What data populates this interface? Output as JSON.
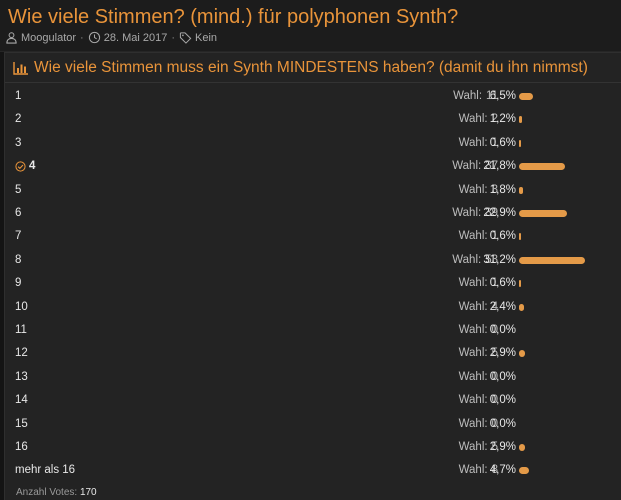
{
  "thread": {
    "title": "Wie viele Stimmen? (mind.) für polyphonen Synth?",
    "author": "Moogulator",
    "date": "28. Mai 2017",
    "tags": "Kein",
    "separator": "·",
    "icons": {
      "author": "user-icon",
      "date": "clock-icon",
      "tags": "tag-icon"
    }
  },
  "poll": {
    "icon": "bar-chart-icon",
    "question": "Wie viele Stimmen muss ein Synth MINDESTENS haben? (damit du ihn nimmst)",
    "vote_prefix": "Wahl:",
    "total_label": "Anzahl Votes:",
    "total_value": "170",
    "bar_color": "#e49a48",
    "accent_color": "#e9943a",
    "options": [
      {
        "label": "1",
        "votes": "11",
        "percent": "6,5%",
        "share": 6.5,
        "voted": false
      },
      {
        "label": "2",
        "votes": "2",
        "percent": "1,2%",
        "share": 1.2,
        "voted": false
      },
      {
        "label": "3",
        "votes": "1",
        "percent": "0,6%",
        "share": 0.6,
        "voted": false
      },
      {
        "label": "4",
        "votes": "37",
        "percent": "21,8%",
        "share": 21.8,
        "voted": true
      },
      {
        "label": "5",
        "votes": "3",
        "percent": "1,8%",
        "share": 1.8,
        "voted": false
      },
      {
        "label": "6",
        "votes": "39",
        "percent": "22,9%",
        "share": 22.9,
        "voted": false
      },
      {
        "label": "7",
        "votes": "1",
        "percent": "0,6%",
        "share": 0.6,
        "voted": false
      },
      {
        "label": "8",
        "votes": "53",
        "percent": "31,2%",
        "share": 31.2,
        "voted": false
      },
      {
        "label": "9",
        "votes": "1",
        "percent": "0,6%",
        "share": 0.6,
        "voted": false
      },
      {
        "label": "10",
        "votes": "4",
        "percent": "2,4%",
        "share": 2.4,
        "voted": false
      },
      {
        "label": "11",
        "votes": "0",
        "percent": "0,0%",
        "share": 0,
        "voted": false
      },
      {
        "label": "12",
        "votes": "5",
        "percent": "2,9%",
        "share": 2.9,
        "voted": false
      },
      {
        "label": "13",
        "votes": "0",
        "percent": "0,0%",
        "share": 0,
        "voted": false
      },
      {
        "label": "14",
        "votes": "0",
        "percent": "0,0%",
        "share": 0,
        "voted": false
      },
      {
        "label": "15",
        "votes": "0",
        "percent": "0,0%",
        "share": 0,
        "voted": false
      },
      {
        "label": "16",
        "votes": "5",
        "percent": "2,9%",
        "share": 2.9,
        "voted": false
      },
      {
        "label": "mehr als 16",
        "votes": "8",
        "percent": "4,7%",
        "share": 4.7,
        "voted": false
      }
    ]
  }
}
